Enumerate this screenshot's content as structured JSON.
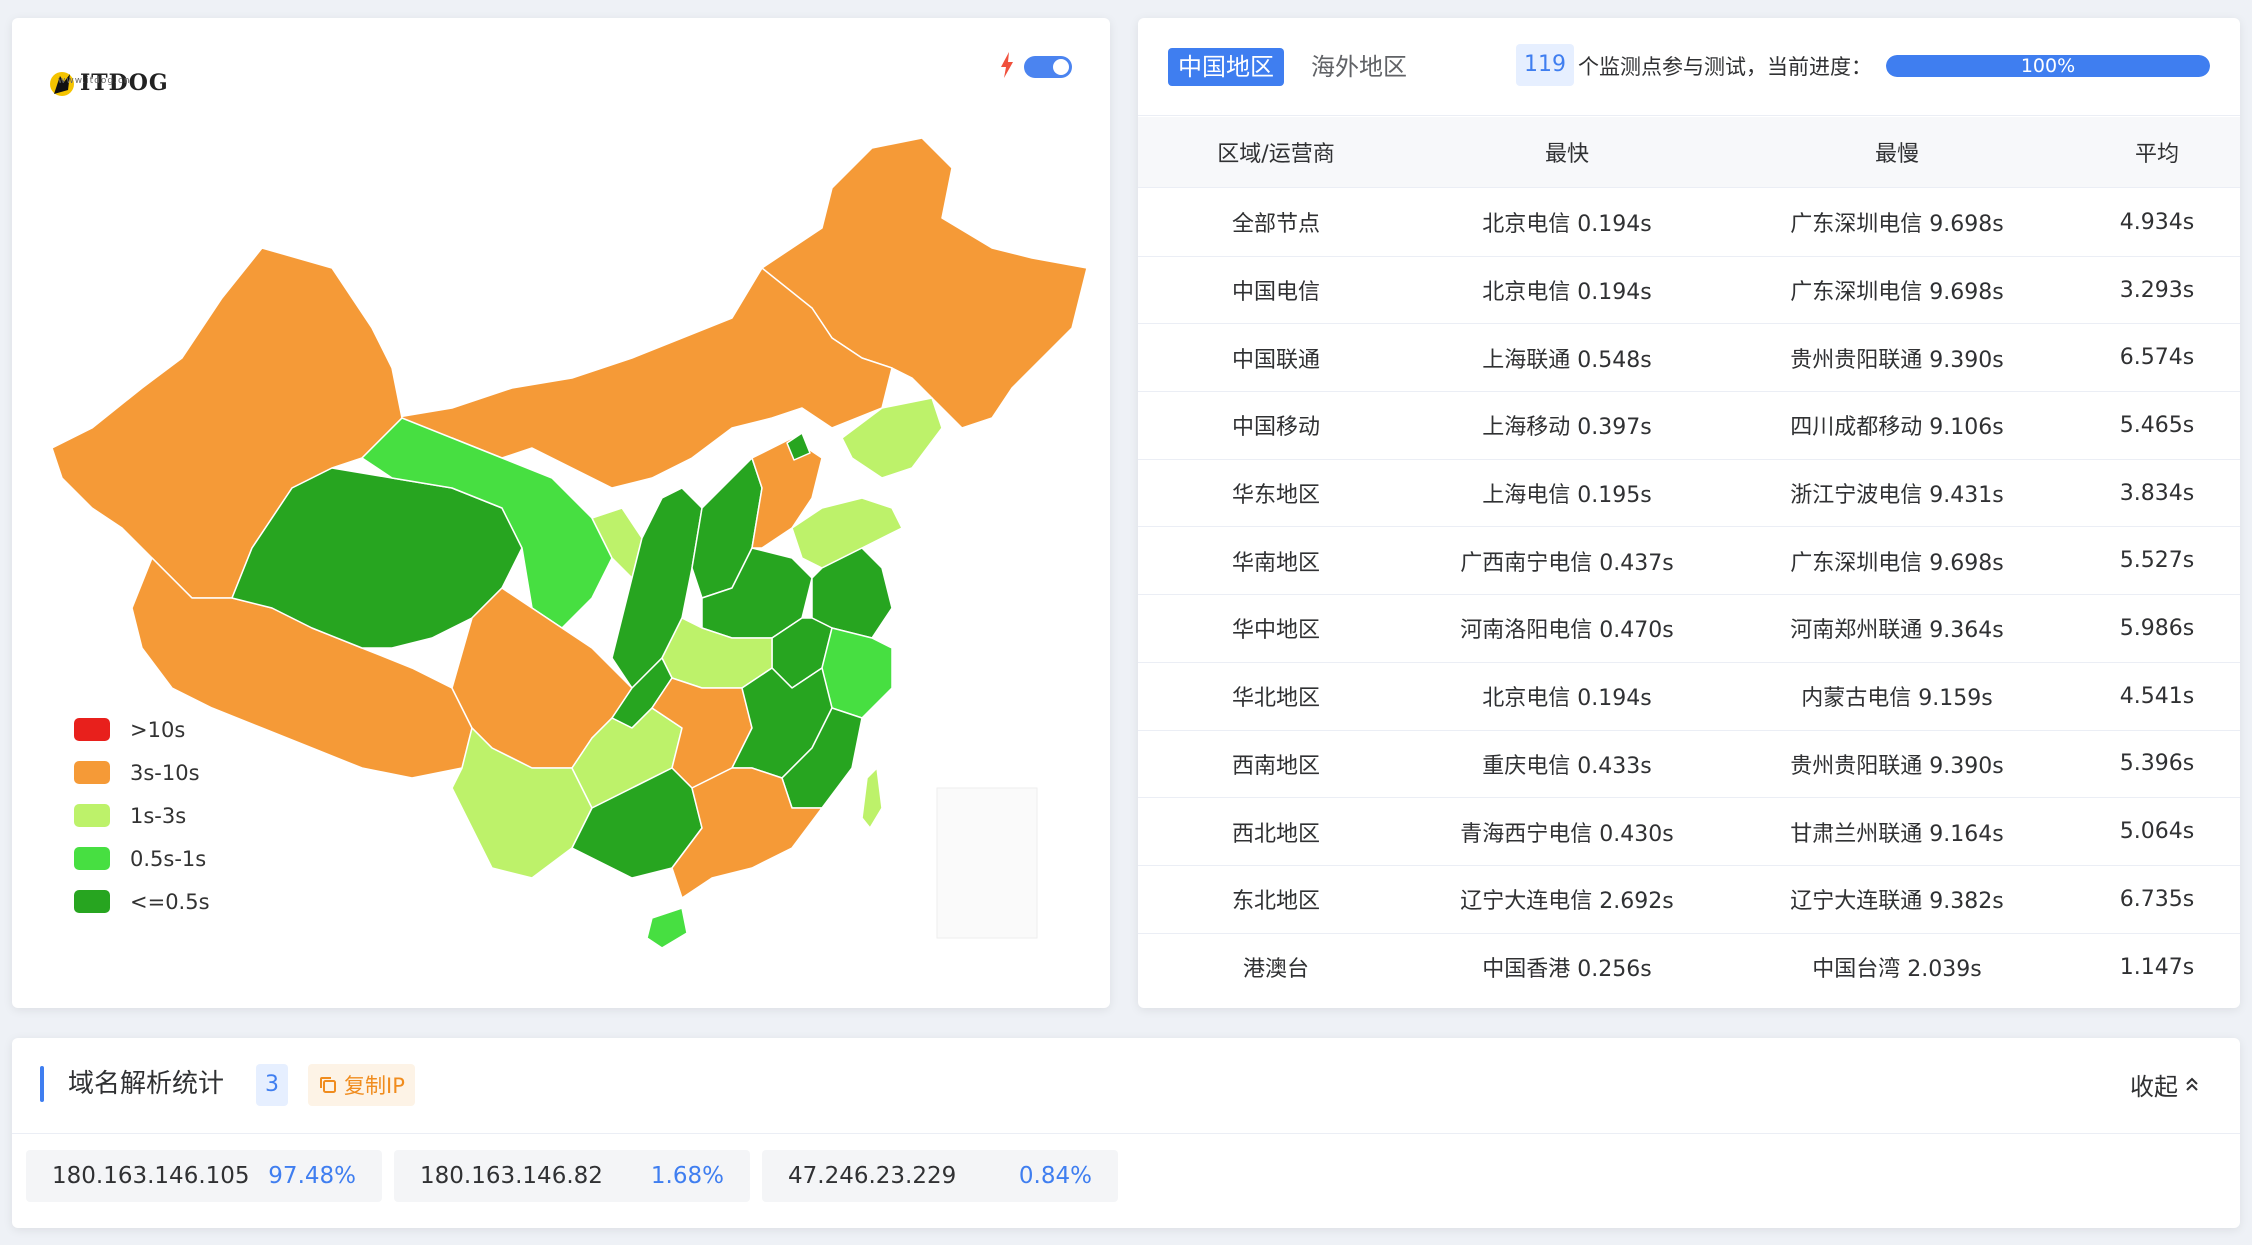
{
  "map": {
    "logo_text": "ITDOG",
    "logo_sub": "www.itdog.cn",
    "legend": [
      {
        "label": ">10s",
        "color": "#e8201c"
      },
      {
        "label": "3s-10s",
        "color": "#f59a37"
      },
      {
        "label": "1s-3s",
        "color": "#bdf26a"
      },
      {
        "label": "0.5s-1s",
        "color": "#47df41"
      },
      {
        "label": "<=0.5s",
        "color": "#27a520"
      }
    ]
  },
  "tabs": [
    {
      "label": "中国地区",
      "active": true
    },
    {
      "label": "海外地区",
      "active": false
    }
  ],
  "status": {
    "count": "119",
    "text": "个监测点参与测试，当前进度：",
    "progress_label": "100%",
    "progress_value": 1.0
  },
  "table": {
    "headers": [
      "区域/运营商",
      "最快",
      "最慢",
      "平均"
    ],
    "rows": [
      [
        "全部节点",
        "北京电信 0.194s",
        "广东深圳电信 9.698s",
        "4.934s"
      ],
      [
        "中国电信",
        "北京电信 0.194s",
        "广东深圳电信 9.698s",
        "3.293s"
      ],
      [
        "中国联通",
        "上海联通 0.548s",
        "贵州贵阳联通 9.390s",
        "6.574s"
      ],
      [
        "中国移动",
        "上海移动 0.397s",
        "四川成都移动 9.106s",
        "5.465s"
      ],
      [
        "华东地区",
        "上海电信 0.195s",
        "浙江宁波电信 9.431s",
        "3.834s"
      ],
      [
        "华南地区",
        "广西南宁电信 0.437s",
        "广东深圳电信 9.698s",
        "5.527s"
      ],
      [
        "华中地区",
        "河南洛阳电信 0.470s",
        "河南郑州联通 9.364s",
        "5.986s"
      ],
      [
        "华北地区",
        "北京电信 0.194s",
        "内蒙古电信 9.159s",
        "4.541s"
      ],
      [
        "西南地区",
        "重庆电信 0.433s",
        "贵州贵阳联通 9.390s",
        "5.396s"
      ],
      [
        "西北地区",
        "青海西宁电信 0.430s",
        "甘肃兰州联通 9.164s",
        "5.064s"
      ],
      [
        "东北地区",
        "辽宁大连电信 2.692s",
        "辽宁大连联通 9.382s",
        "6.735s"
      ],
      [
        "港澳台",
        "中国香港 0.256s",
        "中国台湾 2.039s",
        "1.147s"
      ]
    ]
  },
  "dns": {
    "title": "域名解析统计",
    "count": "3",
    "copy_label": "复制IP",
    "collapse_label": "收起",
    "ips": [
      {
        "ip": "180.163.146.105",
        "pct": "97.48%"
      },
      {
        "ip": "180.163.146.82",
        "pct": "1.68%"
      },
      {
        "ip": "47.246.23.229",
        "pct": "0.84%"
      }
    ]
  },
  "colors": {
    "accent": "#3f7ef0",
    "slow": "#f59a37",
    "medium": "#bdf26a",
    "fast": "#47df41",
    "fastest": "#27a520",
    "error": "#e8201c"
  }
}
